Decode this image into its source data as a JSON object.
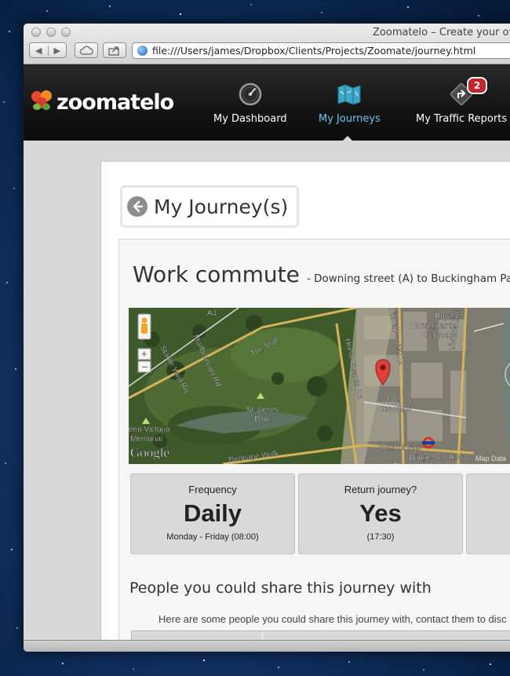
{
  "browser": {
    "window_title": "Zoomatelo – Create your ow",
    "url": "file:///Users/james/Dropbox/Clients/Projects/Zoomate/journey.html",
    "back_glyph": "◀",
    "forward_glyph": "▶"
  },
  "header": {
    "logo_text": "zoomatelo",
    "nav": [
      {
        "label": "My Dashboard",
        "icon": "speedometer-icon",
        "active": false
      },
      {
        "label": "My Journeys",
        "icon": "map-icon",
        "active": true
      },
      {
        "label": "My Traffic Reports",
        "icon": "road-sign-icon",
        "active": false,
        "badge": "2"
      }
    ],
    "active_color": "#6ec6e8"
  },
  "page": {
    "back_title": "My Journey(s)"
  },
  "journey": {
    "name": "Work commute",
    "subtitle": "- Downing street (A) to Buckingham Palace ("
  },
  "map": {
    "labels": {
      "marlborough": "Marlborough Rd",
      "stable_yard": "Stable Yard Rd",
      "the_mall": "The Mall",
      "st_james_park": "St James\nPark",
      "queen_victoria": "een Victoria\nMemorial",
      "birdcage": "Birdcage Walk",
      "horse_guards": "Horse Guards Rd",
      "the_cenotaph": "The\nCenotaph",
      "royal_horseguards": "Royal\nHorseguards\nGuoman",
      "whitehall": "hitehall",
      "a3212": "A3212",
      "victoria_emb": "Victoria Embankment",
      "westminster": "Westminster",
      "bridge_st": "Bridge St",
      "a302": "A302",
      "a4": "A4",
      "map_data": "Map Data",
      "google": "Google"
    }
  },
  "stats": [
    {
      "label": "Frequency",
      "value": "Daily",
      "detail": "Monday - Friday (08:00)"
    },
    {
      "label": "Return journey?",
      "value": "Yes",
      "detail": "(17:30)"
    }
  ],
  "share": {
    "heading": "People you could share this journey with",
    "text": "Here are some people you could share this journey with, contact them to disc"
  }
}
